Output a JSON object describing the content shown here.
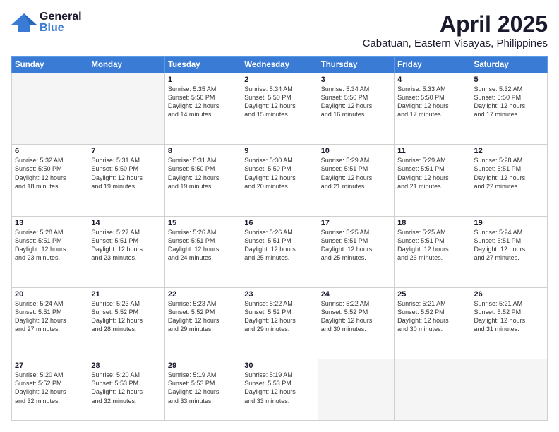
{
  "header": {
    "logo_general": "General",
    "logo_blue": "Blue",
    "title": "April 2025",
    "subtitle": "Cabatuan, Eastern Visayas, Philippines"
  },
  "calendar": {
    "days": [
      "Sunday",
      "Monday",
      "Tuesday",
      "Wednesday",
      "Thursday",
      "Friday",
      "Saturday"
    ],
    "weeks": [
      [
        {
          "num": "",
          "info": ""
        },
        {
          "num": "",
          "info": ""
        },
        {
          "num": "1",
          "info": "Sunrise: 5:35 AM\nSunset: 5:50 PM\nDaylight: 12 hours\nand 14 minutes."
        },
        {
          "num": "2",
          "info": "Sunrise: 5:34 AM\nSunset: 5:50 PM\nDaylight: 12 hours\nand 15 minutes."
        },
        {
          "num": "3",
          "info": "Sunrise: 5:34 AM\nSunset: 5:50 PM\nDaylight: 12 hours\nand 16 minutes."
        },
        {
          "num": "4",
          "info": "Sunrise: 5:33 AM\nSunset: 5:50 PM\nDaylight: 12 hours\nand 17 minutes."
        },
        {
          "num": "5",
          "info": "Sunrise: 5:32 AM\nSunset: 5:50 PM\nDaylight: 12 hours\nand 17 minutes."
        }
      ],
      [
        {
          "num": "6",
          "info": "Sunrise: 5:32 AM\nSunset: 5:50 PM\nDaylight: 12 hours\nand 18 minutes."
        },
        {
          "num": "7",
          "info": "Sunrise: 5:31 AM\nSunset: 5:50 PM\nDaylight: 12 hours\nand 19 minutes."
        },
        {
          "num": "8",
          "info": "Sunrise: 5:31 AM\nSunset: 5:50 PM\nDaylight: 12 hours\nand 19 minutes."
        },
        {
          "num": "9",
          "info": "Sunrise: 5:30 AM\nSunset: 5:50 PM\nDaylight: 12 hours\nand 20 minutes."
        },
        {
          "num": "10",
          "info": "Sunrise: 5:29 AM\nSunset: 5:51 PM\nDaylight: 12 hours\nand 21 minutes."
        },
        {
          "num": "11",
          "info": "Sunrise: 5:29 AM\nSunset: 5:51 PM\nDaylight: 12 hours\nand 21 minutes."
        },
        {
          "num": "12",
          "info": "Sunrise: 5:28 AM\nSunset: 5:51 PM\nDaylight: 12 hours\nand 22 minutes."
        }
      ],
      [
        {
          "num": "13",
          "info": "Sunrise: 5:28 AM\nSunset: 5:51 PM\nDaylight: 12 hours\nand 23 minutes."
        },
        {
          "num": "14",
          "info": "Sunrise: 5:27 AM\nSunset: 5:51 PM\nDaylight: 12 hours\nand 23 minutes."
        },
        {
          "num": "15",
          "info": "Sunrise: 5:26 AM\nSunset: 5:51 PM\nDaylight: 12 hours\nand 24 minutes."
        },
        {
          "num": "16",
          "info": "Sunrise: 5:26 AM\nSunset: 5:51 PM\nDaylight: 12 hours\nand 25 minutes."
        },
        {
          "num": "17",
          "info": "Sunrise: 5:25 AM\nSunset: 5:51 PM\nDaylight: 12 hours\nand 25 minutes."
        },
        {
          "num": "18",
          "info": "Sunrise: 5:25 AM\nSunset: 5:51 PM\nDaylight: 12 hours\nand 26 minutes."
        },
        {
          "num": "19",
          "info": "Sunrise: 5:24 AM\nSunset: 5:51 PM\nDaylight: 12 hours\nand 27 minutes."
        }
      ],
      [
        {
          "num": "20",
          "info": "Sunrise: 5:24 AM\nSunset: 5:51 PM\nDaylight: 12 hours\nand 27 minutes."
        },
        {
          "num": "21",
          "info": "Sunrise: 5:23 AM\nSunset: 5:52 PM\nDaylight: 12 hours\nand 28 minutes."
        },
        {
          "num": "22",
          "info": "Sunrise: 5:23 AM\nSunset: 5:52 PM\nDaylight: 12 hours\nand 29 minutes."
        },
        {
          "num": "23",
          "info": "Sunrise: 5:22 AM\nSunset: 5:52 PM\nDaylight: 12 hours\nand 29 minutes."
        },
        {
          "num": "24",
          "info": "Sunrise: 5:22 AM\nSunset: 5:52 PM\nDaylight: 12 hours\nand 30 minutes."
        },
        {
          "num": "25",
          "info": "Sunrise: 5:21 AM\nSunset: 5:52 PM\nDaylight: 12 hours\nand 30 minutes."
        },
        {
          "num": "26",
          "info": "Sunrise: 5:21 AM\nSunset: 5:52 PM\nDaylight: 12 hours\nand 31 minutes."
        }
      ],
      [
        {
          "num": "27",
          "info": "Sunrise: 5:20 AM\nSunset: 5:52 PM\nDaylight: 12 hours\nand 32 minutes."
        },
        {
          "num": "28",
          "info": "Sunrise: 5:20 AM\nSunset: 5:53 PM\nDaylight: 12 hours\nand 32 minutes."
        },
        {
          "num": "29",
          "info": "Sunrise: 5:19 AM\nSunset: 5:53 PM\nDaylight: 12 hours\nand 33 minutes."
        },
        {
          "num": "30",
          "info": "Sunrise: 5:19 AM\nSunset: 5:53 PM\nDaylight: 12 hours\nand 33 minutes."
        },
        {
          "num": "",
          "info": ""
        },
        {
          "num": "",
          "info": ""
        },
        {
          "num": "",
          "info": ""
        }
      ]
    ]
  }
}
